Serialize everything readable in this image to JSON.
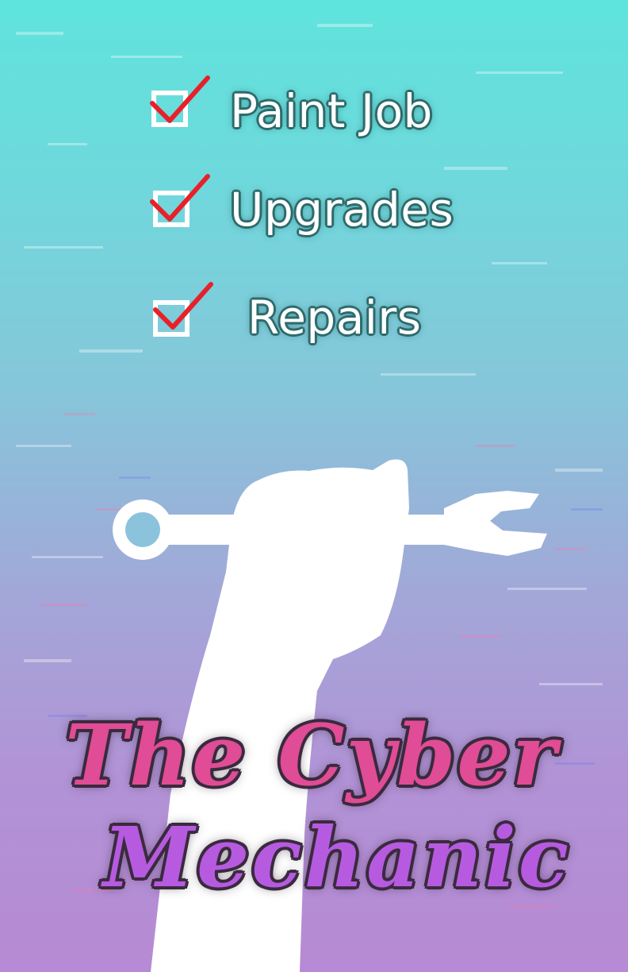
{
  "checklist": {
    "items": [
      {
        "label": "Paint Job",
        "checked": true
      },
      {
        "label": "Upgrades",
        "checked": true
      },
      {
        "label": "Repairs",
        "checked": true
      }
    ],
    "checkbox_color": "#ffffff",
    "checkmark_color": "#e8202a"
  },
  "logo": {
    "line1": "The Cyber",
    "line2": "Mechanic",
    "line1_color": "#e04c95",
    "line2_color": "#b65be0"
  },
  "illustration": {
    "name": "raised-fist-holding-wrench",
    "color": "#ffffff"
  },
  "colors": {
    "background_top": "#5fe3dd",
    "background_bottom": "#b68ad4"
  }
}
